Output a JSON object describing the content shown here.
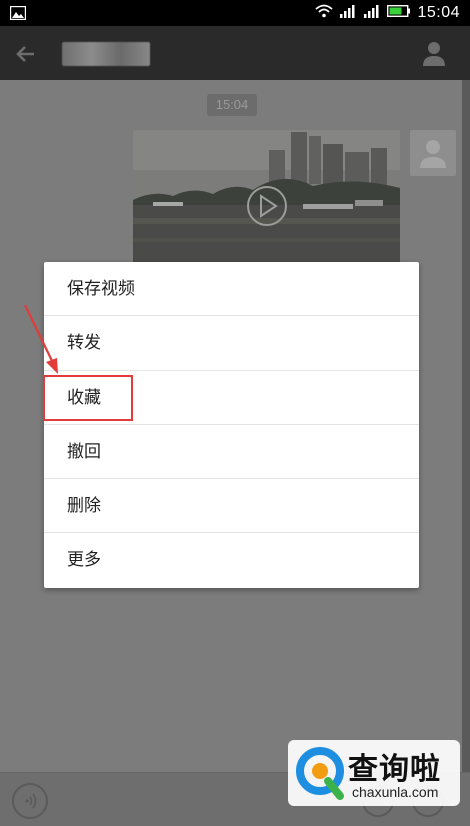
{
  "status_bar": {
    "time": "15:04",
    "left_icon": "image-notification-icon",
    "right_icons": [
      "wifi-icon",
      "signal-icon",
      "signal-icon",
      "battery-icon"
    ]
  },
  "header": {
    "back_icon": "arrow-left-icon",
    "contact_name": "",
    "profile_icon": "person-icon"
  },
  "chat": {
    "timestamp": "15:04",
    "message_type": "video",
    "play_icon": "play-icon"
  },
  "context_menu": {
    "items": [
      {
        "label": "保存视频"
      },
      {
        "label": "转发"
      },
      {
        "label": "收藏"
      },
      {
        "label": "撤回"
      },
      {
        "label": "删除"
      },
      {
        "label": "更多"
      }
    ],
    "highlighted_index": 2,
    "highlight_color": "#e23b3b"
  },
  "bottom_bar": {
    "voice_icon": "voice-icon",
    "emoji_icon": "emoji-icon",
    "more_icon": "plus-icon"
  },
  "watermark": {
    "brand": "查询啦",
    "domain": "chaxunla.com"
  }
}
